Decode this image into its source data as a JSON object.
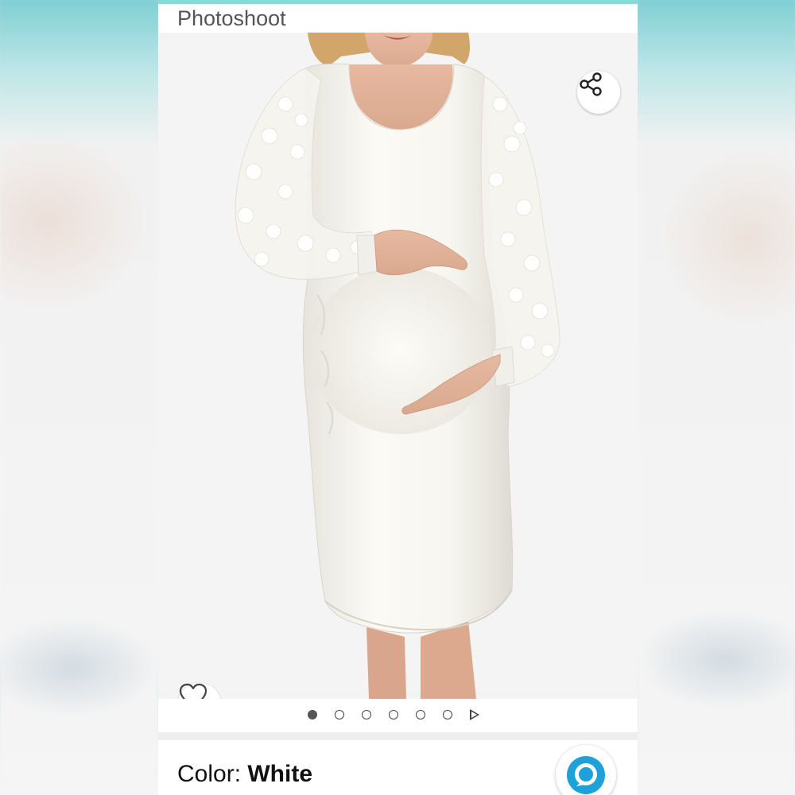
{
  "header": {
    "title": "Photoshoot"
  },
  "image": {
    "description_icon": "product-photo",
    "share_icon": "share-icon",
    "favorite_icon": "heart-icon"
  },
  "pager": {
    "total_dots": 6,
    "active_index": 0
  },
  "color_selector": {
    "label": "Color: ",
    "value": "White"
  },
  "colors": {
    "accent_top": "#8fd6d8",
    "alexa_blue": "#1ea1d9"
  }
}
